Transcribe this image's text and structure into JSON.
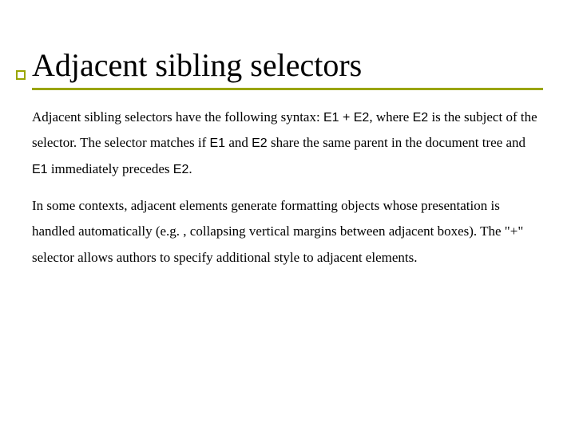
{
  "title": "Adjacent sibling selectors",
  "p1": {
    "t1": "Adjacent sibling selectors have the following syntax: ",
    "c1": "E1 + E2",
    "t2": ", where ",
    "c2": "E2",
    "t3": " is the subject of the selector. The selector matches if ",
    "c3": "E1",
    "t4": " and ",
    "c4": "E2",
    "t5": " share the same parent in the document tree and ",
    "c5": "E1",
    "t6": " immediately precedes ",
    "c6": "E2",
    "t7": "."
  },
  "p2": "In some contexts, adjacent elements generate formatting objects whose presentation is handled automatically (e.g. , collapsing vertical margins between adjacent boxes). The \"+\" selector allows authors to specify additional style to adjacent elements."
}
